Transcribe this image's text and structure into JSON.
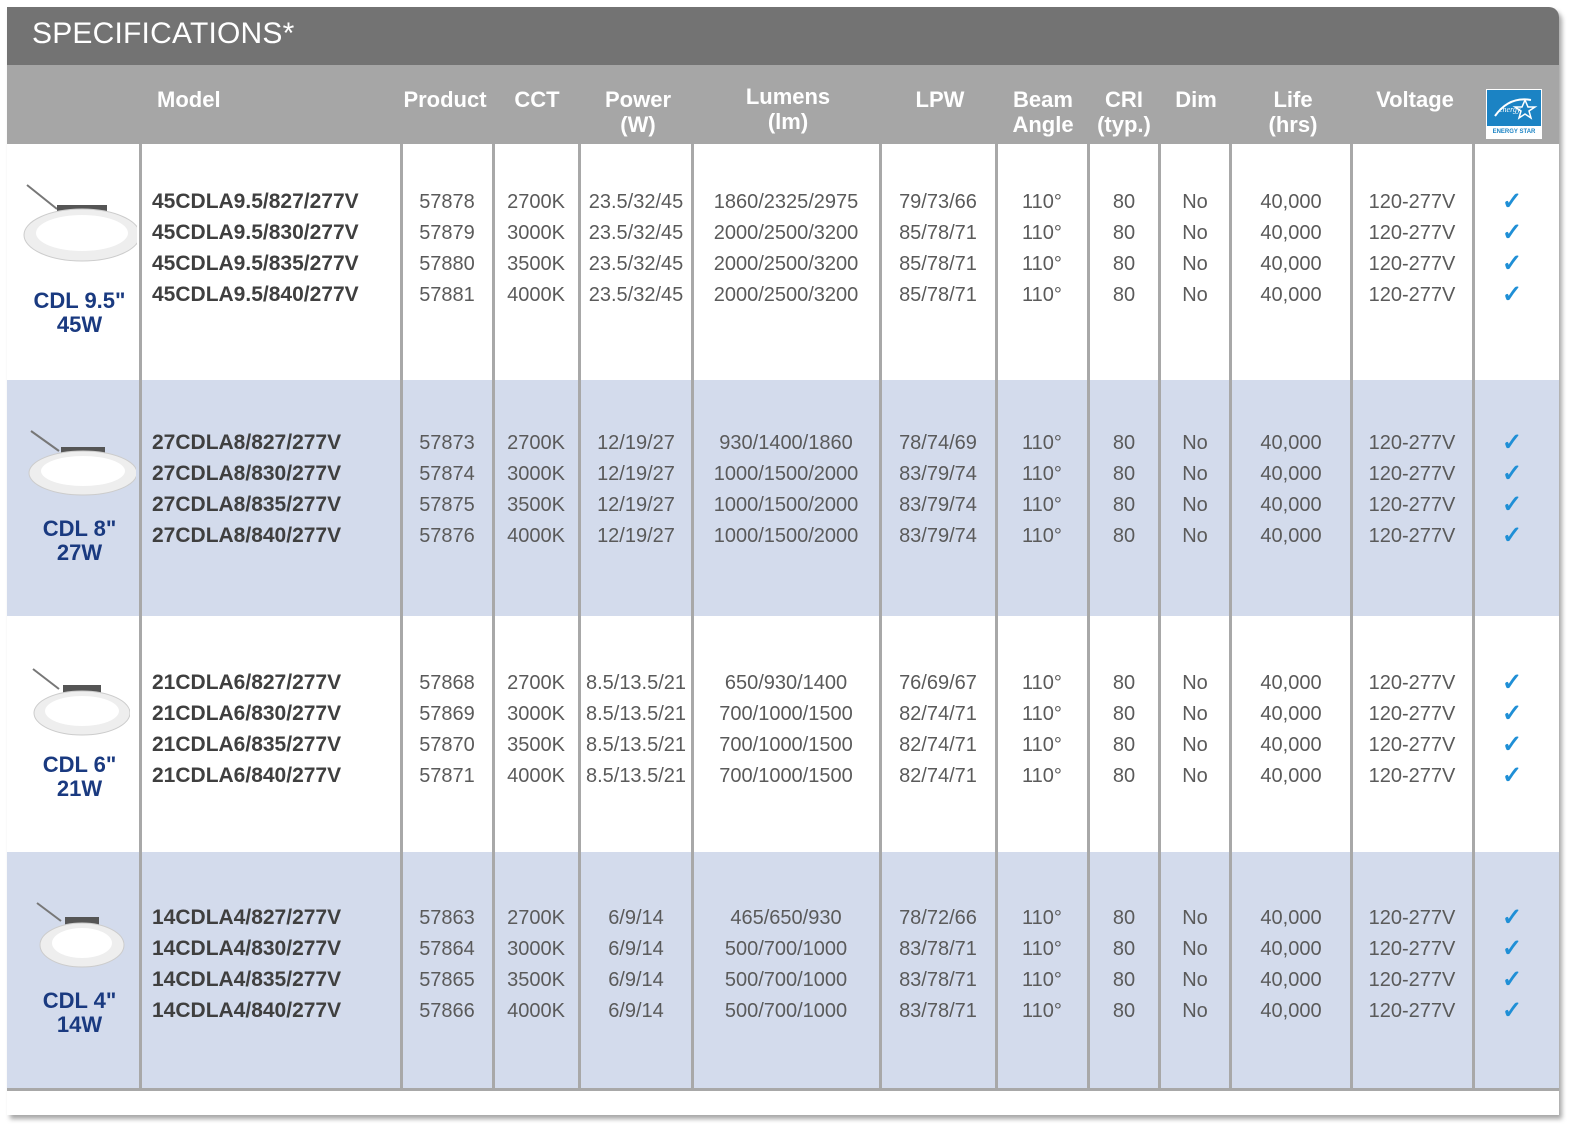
{
  "title": "SPECIFICATIONS*",
  "header": {
    "model": "Model",
    "product": "Product",
    "cct": "CCT",
    "power": [
      "Power",
      "(W)"
    ],
    "lumens": [
      "Lumens",
      "(lm)"
    ],
    "lpw": "LPW",
    "beam": [
      "Beam",
      "Angle"
    ],
    "cri": [
      "CRI",
      "(typ.)"
    ],
    "dim": "Dim",
    "life": [
      "Life",
      "(hrs)"
    ],
    "voltage": "Voltage",
    "energy_star": "ENERGY STAR"
  },
  "groups": [
    {
      "name": [
        "CDL 9.5\"",
        "45W"
      ],
      "rows": [
        {
          "model": "45CDLA9.5/827/277V",
          "product": "57878",
          "cct": "2700K",
          "power": "23.5/32/45",
          "lumens": "1860/2325/2975",
          "lpw": "79/73/66",
          "beam": "110°",
          "cri": "80",
          "dim": "No",
          "life": "40,000",
          "voltage": "120-277V",
          "check": "✓"
        },
        {
          "model": "45CDLA9.5/830/277V",
          "product": "57879",
          "cct": "3000K",
          "power": "23.5/32/45",
          "lumens": "2000/2500/3200",
          "lpw": "85/78/71",
          "beam": "110°",
          "cri": "80",
          "dim": "No",
          "life": "40,000",
          "voltage": "120-277V",
          "check": "✓"
        },
        {
          "model": "45CDLA9.5/835/277V",
          "product": "57880",
          "cct": "3500K",
          "power": "23.5/32/45",
          "lumens": "2000/2500/3200",
          "lpw": "85/78/71",
          "beam": "110°",
          "cri": "80",
          "dim": "No",
          "life": "40,000",
          "voltage": "120-277V",
          "check": "✓"
        },
        {
          "model": "45CDLA9.5/840/277V",
          "product": "57881",
          "cct": "4000K",
          "power": "23.5/32/45",
          "lumens": "2000/2500/3200",
          "lpw": "85/78/71",
          "beam": "110°",
          "cri": "80",
          "dim": "No",
          "life": "40,000",
          "voltage": "120-277V",
          "check": "✓"
        }
      ]
    },
    {
      "name": [
        "CDL 8\"",
        "27W"
      ],
      "rows": [
        {
          "model": "27CDLA8/827/277V",
          "product": "57873",
          "cct": "2700K",
          "power": "12/19/27",
          "lumens": "930/1400/1860",
          "lpw": "78/74/69",
          "beam": "110°",
          "cri": "80",
          "dim": "No",
          "life": "40,000",
          "voltage": "120-277V",
          "check": "✓"
        },
        {
          "model": "27CDLA8/830/277V",
          "product": "57874",
          "cct": "3000K",
          "power": "12/19/27",
          "lumens": "1000/1500/2000",
          "lpw": "83/79/74",
          "beam": "110°",
          "cri": "80",
          "dim": "No",
          "life": "40,000",
          "voltage": "120-277V",
          "check": "✓"
        },
        {
          "model": "27CDLA8/835/277V",
          "product": "57875",
          "cct": "3500K",
          "power": "12/19/27",
          "lumens": "1000/1500/2000",
          "lpw": "83/79/74",
          "beam": "110°",
          "cri": "80",
          "dim": "No",
          "life": "40,000",
          "voltage": "120-277V",
          "check": "✓"
        },
        {
          "model": "27CDLA8/840/277V",
          "product": "57876",
          "cct": "4000K",
          "power": "12/19/27",
          "lumens": "1000/1500/2000",
          "lpw": "83/79/74",
          "beam": "110°",
          "cri": "80",
          "dim": "No",
          "life": "40,000",
          "voltage": "120-277V",
          "check": "✓"
        }
      ]
    },
    {
      "name": [
        "CDL 6\"",
        "21W"
      ],
      "rows": [
        {
          "model": "21CDLA6/827/277V",
          "product": "57868",
          "cct": "2700K",
          "power": "8.5/13.5/21",
          "lumens": "650/930/1400",
          "lpw": "76/69/67",
          "beam": "110°",
          "cri": "80",
          "dim": "No",
          "life": "40,000",
          "voltage": "120-277V",
          "check": "✓"
        },
        {
          "model": "21CDLA6/830/277V",
          "product": "57869",
          "cct": "3000K",
          "power": "8.5/13.5/21",
          "lumens": "700/1000/1500",
          "lpw": "82/74/71",
          "beam": "110°",
          "cri": "80",
          "dim": "No",
          "life": "40,000",
          "voltage": "120-277V",
          "check": "✓"
        },
        {
          "model": "21CDLA6/835/277V",
          "product": "57870",
          "cct": "3500K",
          "power": "8.5/13.5/21",
          "lumens": "700/1000/1500",
          "lpw": "82/74/71",
          "beam": "110°",
          "cri": "80",
          "dim": "No",
          "life": "40,000",
          "voltage": "120-277V",
          "check": "✓"
        },
        {
          "model": "21CDLA6/840/277V",
          "product": "57871",
          "cct": "4000K",
          "power": "8.5/13.5/21",
          "lumens": "700/1000/1500",
          "lpw": "82/74/71",
          "beam": "110°",
          "cri": "80",
          "dim": "No",
          "life": "40,000",
          "voltage": "120-277V",
          "check": "✓"
        }
      ]
    },
    {
      "name": [
        "CDL 4\"",
        "14W"
      ],
      "rows": [
        {
          "model": "14CDLA4/827/277V",
          "product": "57863",
          "cct": "2700K",
          "power": "6/9/14",
          "lumens": "465/650/930",
          "lpw": "78/72/66",
          "beam": "110°",
          "cri": "80",
          "dim": "No",
          "life": "40,000",
          "voltage": "120-277V",
          "check": "✓"
        },
        {
          "model": "14CDLA4/830/277V",
          "product": "57864",
          "cct": "3000K",
          "power": "6/9/14",
          "lumens": "500/700/1000",
          "lpw": "83/78/71",
          "beam": "110°",
          "cri": "80",
          "dim": "No",
          "life": "40,000",
          "voltage": "120-277V",
          "check": "✓"
        },
        {
          "model": "14CDLA4/835/277V",
          "product": "57865",
          "cct": "3500K",
          "power": "6/9/14",
          "lumens": "500/700/1000",
          "lpw": "83/78/71",
          "beam": "110°",
          "cri": "80",
          "dim": "No",
          "life": "40,000",
          "voltage": "120-277V",
          "check": "✓"
        },
        {
          "model": "14CDLA4/840/277V",
          "product": "57866",
          "cct": "4000K",
          "power": "6/9/14",
          "lumens": "500/700/1000",
          "lpw": "83/78/71",
          "beam": "110°",
          "cri": "80",
          "dim": "No",
          "life": "40,000",
          "voltage": "120-277V",
          "check": "✓"
        }
      ]
    }
  ],
  "colors": {
    "title_bar": "#737373",
    "header_bar": "#a6a6a6",
    "alt_row": "#d3dbec",
    "product_label": "#1a3a80",
    "check": "#1f8fd6",
    "energy_star": "#1b83c4"
  }
}
